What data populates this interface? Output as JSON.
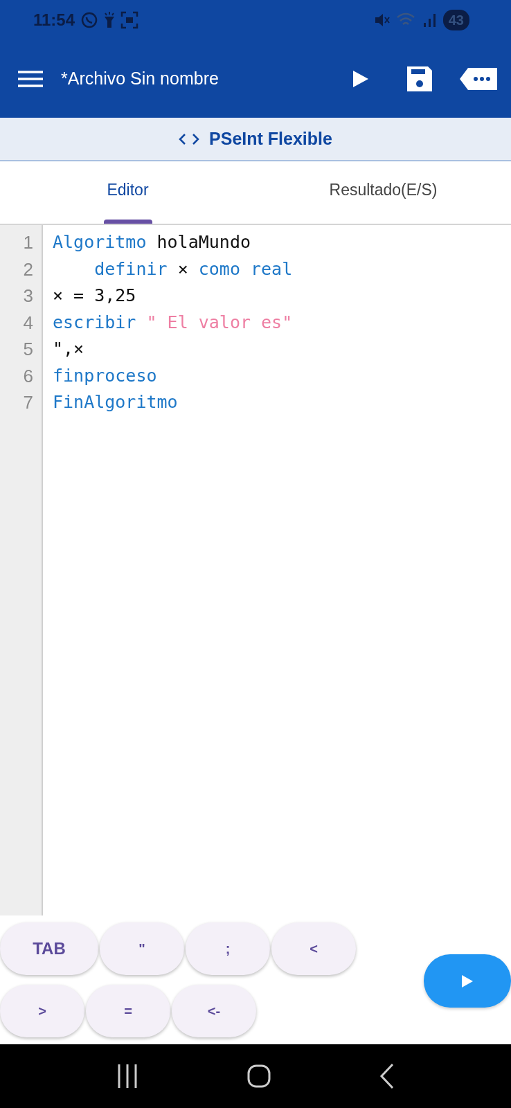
{
  "status_bar": {
    "time": "11:54",
    "battery": "43"
  },
  "app_bar": {
    "title": "*Archivo Sin nombre"
  },
  "mode_bar": {
    "label": "PSeInt Flexible"
  },
  "tabs": [
    {
      "label": "Editor",
      "selected": true
    },
    {
      "label": "Resultado(E/S)",
      "selected": false
    }
  ],
  "editor": {
    "lines": [
      {
        "number": "1",
        "tokens": [
          {
            "kind": "keyword",
            "text": "Algoritmo"
          },
          {
            "kind": "plain",
            "text": " holaMundo"
          }
        ]
      },
      {
        "number": "2",
        "tokens": [
          {
            "kind": "keyword",
            "text": "    definir"
          },
          {
            "kind": "plain",
            "text": " ×"
          },
          {
            "kind": "keyword",
            "text": " como real"
          }
        ]
      },
      {
        "number": "3",
        "tokens": [
          {
            "kind": "plain",
            "text": "× = 3,25"
          }
        ]
      },
      {
        "number": "4",
        "tokens": [
          {
            "kind": "keyword",
            "text": "escribir"
          },
          {
            "kind": "string",
            "text": " \" El valor es\""
          }
        ]
      },
      {
        "number": "5",
        "tokens": [
          {
            "kind": "plain",
            "text": "\",×"
          }
        ]
      },
      {
        "number": "6",
        "tokens": [
          {
            "kind": "keyword",
            "text": "finproceso"
          }
        ]
      },
      {
        "number": "7",
        "tokens": [
          {
            "kind": "keyword",
            "text": "FinAlgoritmo"
          }
        ]
      }
    ]
  },
  "key_rows": [
    [
      {
        "label": "TAB"
      },
      {
        "label": "\""
      },
      {
        "label": ";"
      },
      {
        "label": "<"
      }
    ],
    [
      {
        "label": ">"
      },
      {
        "label": "="
      },
      {
        "label": "<-"
      }
    ]
  ]
}
